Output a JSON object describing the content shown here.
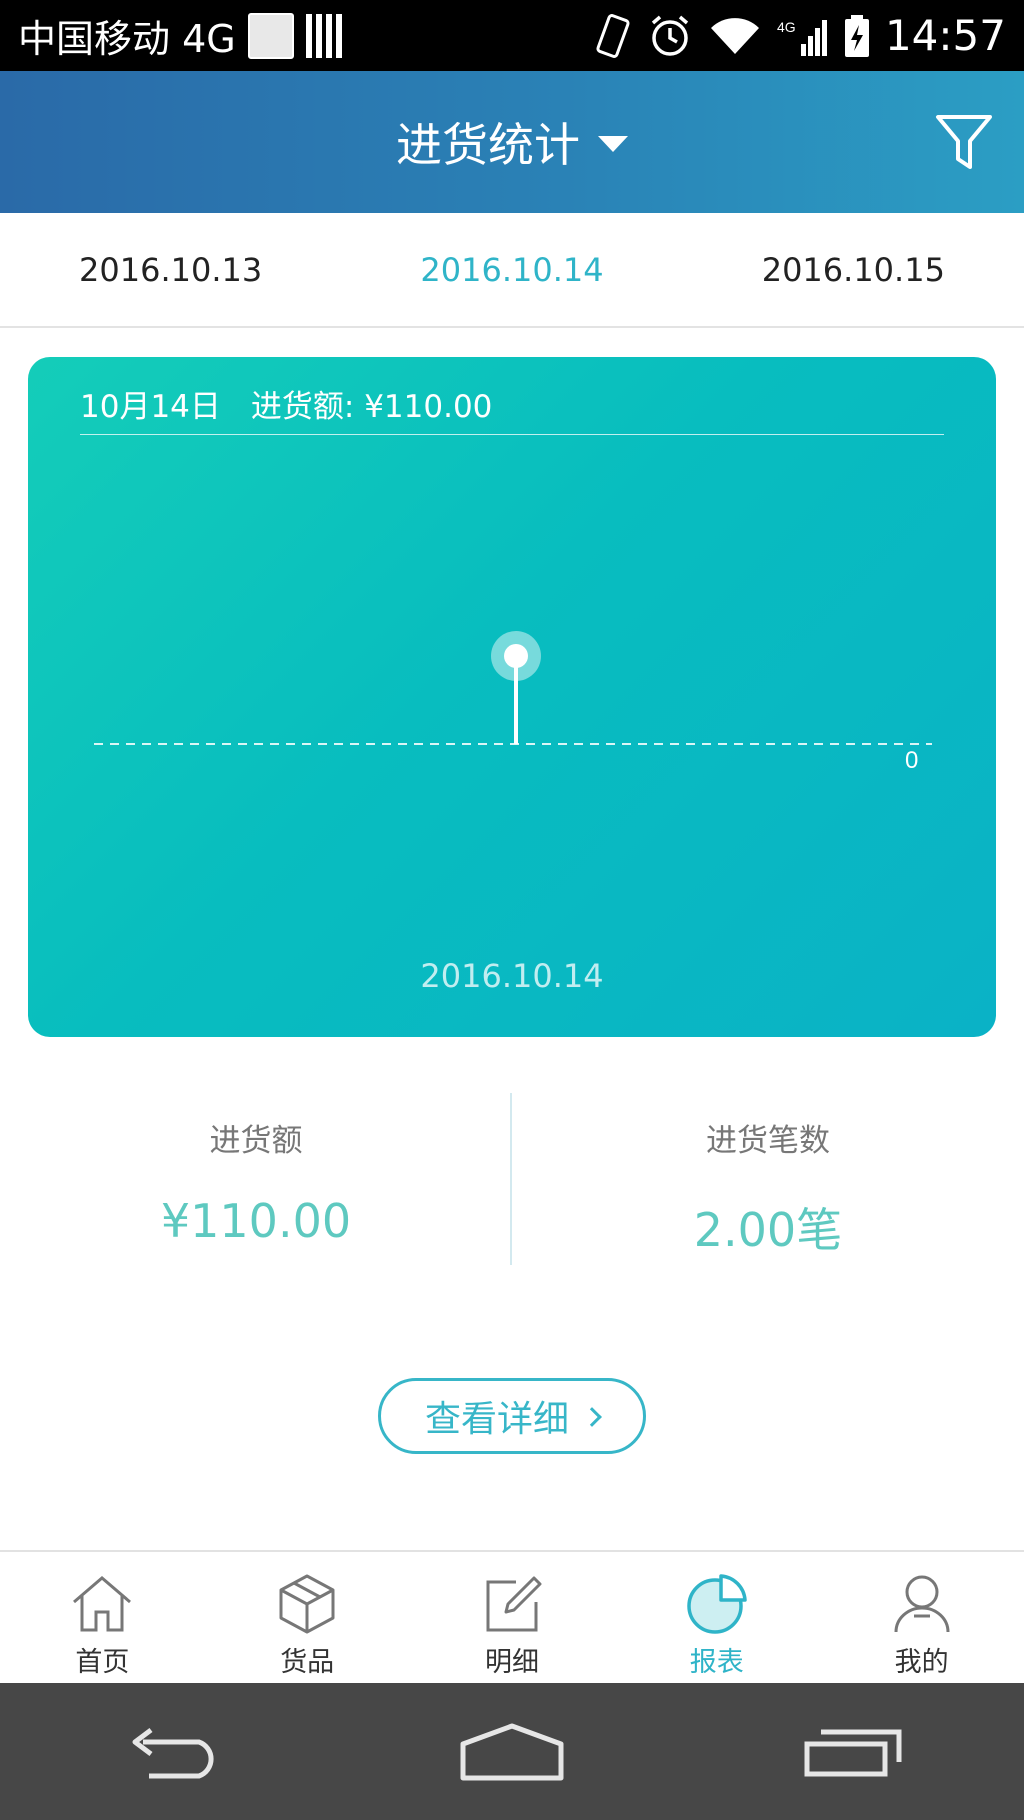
{
  "status_bar": {
    "carrier": "中国移动 4G",
    "time": "14:57",
    "network": "4G"
  },
  "header": {
    "title": "进货统计",
    "title_caret_icon": "caret-down-icon",
    "filter_icon": "filter-icon",
    "gradient": [
      "#2a6aa8",
      "#2b9ec4"
    ]
  },
  "date_tabs": [
    {
      "label": "2016.10.13",
      "active": false
    },
    {
      "label": "2016.10.14",
      "active": true
    },
    {
      "label": "2016.10.15",
      "active": false
    }
  ],
  "chart": {
    "heading_date": "10月14日",
    "heading_amount": "进货额: ¥110.00",
    "zero_label": "0",
    "x_label": "2016.10.14"
  },
  "chart_data": {
    "type": "line",
    "title": "10月14日 进货额: ¥110.00",
    "xlabel": "",
    "ylabel": "",
    "x": [
      "2016.10.14"
    ],
    "series": [
      {
        "values": [
          110.0
        ]
      }
    ],
    "baseline": 0,
    "grid": false
  },
  "stats": {
    "amount_label": "进货额",
    "amount_value": "¥110.00",
    "count_label": "进货笔数",
    "count_value": "2.00笔",
    "value_color": "#5ec9c0"
  },
  "detail_button": {
    "label": "查看详细",
    "icon": "chevron-right-icon"
  },
  "bottom_nav": [
    {
      "label": "首页",
      "icon": "home-icon",
      "active": false
    },
    {
      "label": "货品",
      "icon": "box-icon",
      "active": false
    },
    {
      "label": "明细",
      "icon": "edit-icon",
      "active": false
    },
    {
      "label": "报表",
      "icon": "pie-chart-icon",
      "active": true
    },
    {
      "label": "我的",
      "icon": "user-icon",
      "active": false
    }
  ],
  "system_nav": [
    "back-icon",
    "home-icon",
    "recents-icon"
  ],
  "colors": {
    "accent": "#2fb4c8",
    "card_start": "#14cdb9",
    "card_end": "#0ab2c6"
  }
}
